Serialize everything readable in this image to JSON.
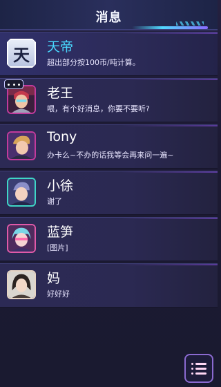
{
  "header": {
    "title": "消息"
  },
  "conversations": [
    {
      "name": "天帝",
      "preview": "超出部分按100币/吨计算。",
      "avatar_glyph": "天"
    },
    {
      "name": "老王",
      "preview": "喂，有个好消息，你要不要听?"
    },
    {
      "name": "Tony",
      "preview": "办卡么~不办的话我等会再来问一遍~"
    },
    {
      "name": "小徐",
      "preview": "谢了"
    },
    {
      "name": "蓝笋",
      "preview": "[图片]"
    },
    {
      "name": "妈",
      "preview": "好好好"
    }
  ],
  "icons": {
    "typing_indicator": "ellipsis-icon",
    "menu": "menu-icon"
  },
  "colors": {
    "accent": "#49d9ff",
    "header_bg": "#2a2f5c",
    "list_bg": "#2c2a55",
    "menu_border": "#8b6ad1"
  }
}
